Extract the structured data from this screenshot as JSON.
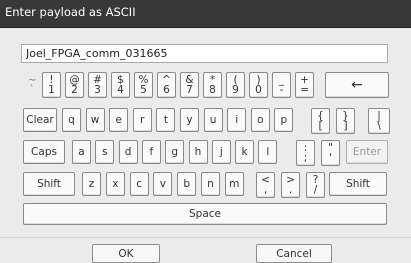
{
  "window": {
    "title": "Enter payload as ASCII"
  },
  "input": {
    "value": "Joel_FPGA_comm_031665"
  },
  "keyboard": {
    "row1": [
      {
        "top": "~",
        "bottom": "`"
      },
      {
        "top": "!",
        "bottom": "1"
      },
      {
        "top": "@",
        "bottom": "2"
      },
      {
        "top": "#",
        "bottom": "3"
      },
      {
        "top": "$",
        "bottom": "4"
      },
      {
        "top": "%",
        "bottom": "5"
      },
      {
        "top": "^",
        "bottom": "6"
      },
      {
        "top": "&",
        "bottom": "7"
      },
      {
        "top": "*",
        "bottom": "8"
      },
      {
        "top": "(",
        "bottom": "9"
      },
      {
        "top": ")",
        "bottom": "0"
      },
      {
        "top": "_",
        "bottom": "-"
      },
      {
        "top": "+",
        "bottom": "="
      }
    ],
    "backspace": "←",
    "clear": "Clear",
    "row2": [
      "q",
      "w",
      "e",
      "r",
      "t",
      "y",
      "u",
      "i",
      "o",
      "p"
    ],
    "row2_brackets": [
      {
        "top": "{",
        "bottom": "["
      },
      {
        "top": "}",
        "bottom": "]"
      },
      {
        "top": "|",
        "bottom": "\\"
      }
    ],
    "caps": "Caps",
    "row3": [
      "a",
      "s",
      "d",
      "f",
      "g",
      "h",
      "j",
      "k",
      "l"
    ],
    "row3_punct": [
      {
        "top": ":",
        "bottom": ";"
      },
      {
        "top": "\"",
        "bottom": "'"
      }
    ],
    "enter": "Enter",
    "shift_left": "Shift",
    "row4": [
      "z",
      "x",
      "c",
      "v",
      "b",
      "n",
      "m"
    ],
    "row4_punct": [
      {
        "top": "<",
        "bottom": ","
      },
      {
        "top": ">",
        "bottom": "."
      },
      {
        "top": "?",
        "bottom": "/"
      }
    ],
    "shift_right": "Shift",
    "space": "Space"
  },
  "buttons": {
    "ok": "OK",
    "cancel": "Cancel"
  },
  "colors": {
    "titlebar": "#383838",
    "background": "#ebebeb",
    "key_face": "#fafafa",
    "key_border": "#8a8a8a"
  }
}
